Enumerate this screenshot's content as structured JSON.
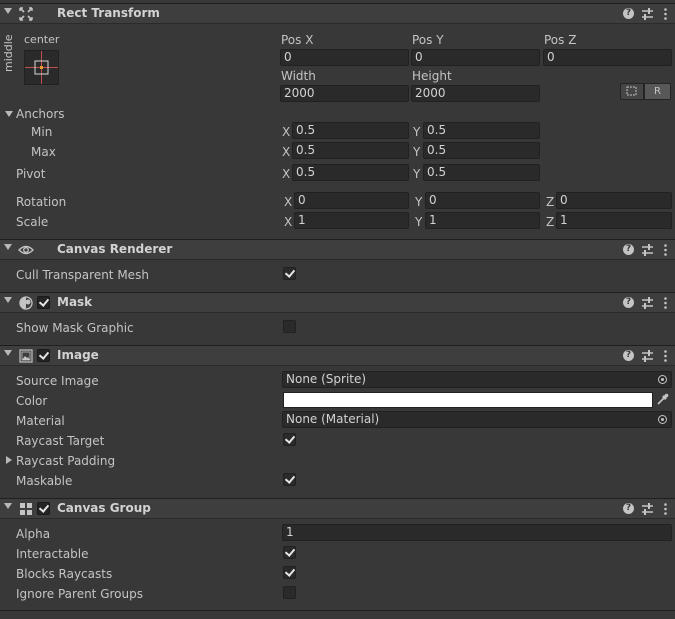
{
  "rect_transform": {
    "title": "Rect Transform",
    "anchor_h": "center",
    "anchor_v": "middle",
    "pos_x_label": "Pos X",
    "pos_y_label": "Pos Y",
    "pos_z_label": "Pos Z",
    "pos_x": "0",
    "pos_y": "0",
    "pos_z": "0",
    "width_label": "Width",
    "height_label": "Height",
    "width": "2000",
    "height": "2000",
    "raw_button": "R",
    "anchors_label": "Anchors",
    "min_label": "Min",
    "max_label": "Max",
    "min_x": "0.5",
    "min_y": "0.5",
    "max_x": "0.5",
    "max_y": "0.5",
    "pivot_label": "Pivot",
    "pivot_x": "0.5",
    "pivot_y": "0.5",
    "rotation_label": "Rotation",
    "rot_x": "0",
    "rot_y": "0",
    "rot_z": "0",
    "scale_label": "Scale",
    "scale_x": "1",
    "scale_y": "1",
    "scale_z": "1",
    "axis_x": "X",
    "axis_y": "Y",
    "axis_z": "Z"
  },
  "canvas_renderer": {
    "title": "Canvas Renderer",
    "cull_label": "Cull Transparent Mesh",
    "cull_checked": true
  },
  "mask": {
    "title": "Mask",
    "enabled": true,
    "show_graphic_label": "Show Mask Graphic",
    "show_graphic_checked": false
  },
  "image": {
    "title": "Image",
    "enabled": true,
    "source_label": "Source Image",
    "source_value": "None (Sprite)",
    "color_label": "Color",
    "color_value": "#ffffff",
    "material_label": "Material",
    "material_value": "None (Material)",
    "raycast_target_label": "Raycast Target",
    "raycast_target_checked": true,
    "raycast_padding_label": "Raycast Padding",
    "maskable_label": "Maskable",
    "maskable_checked": true
  },
  "canvas_group": {
    "title": "Canvas Group",
    "enabled": true,
    "alpha_label": "Alpha",
    "alpha_value": "1",
    "interactable_label": "Interactable",
    "interactable_checked": true,
    "blocks_label": "Blocks Raycasts",
    "blocks_checked": true,
    "ignore_label": "Ignore Parent Groups",
    "ignore_checked": false
  },
  "icons": {
    "help": "?",
    "help_name": "help-icon",
    "presets_name": "presets-icon",
    "menu_name": "kebab-menu-icon"
  },
  "colors": {
    "background": "#383838",
    "header": "#3e3e3e",
    "field": "#2a2a2a",
    "text": "#c4c4c4",
    "anchor_red": "#e04040"
  }
}
